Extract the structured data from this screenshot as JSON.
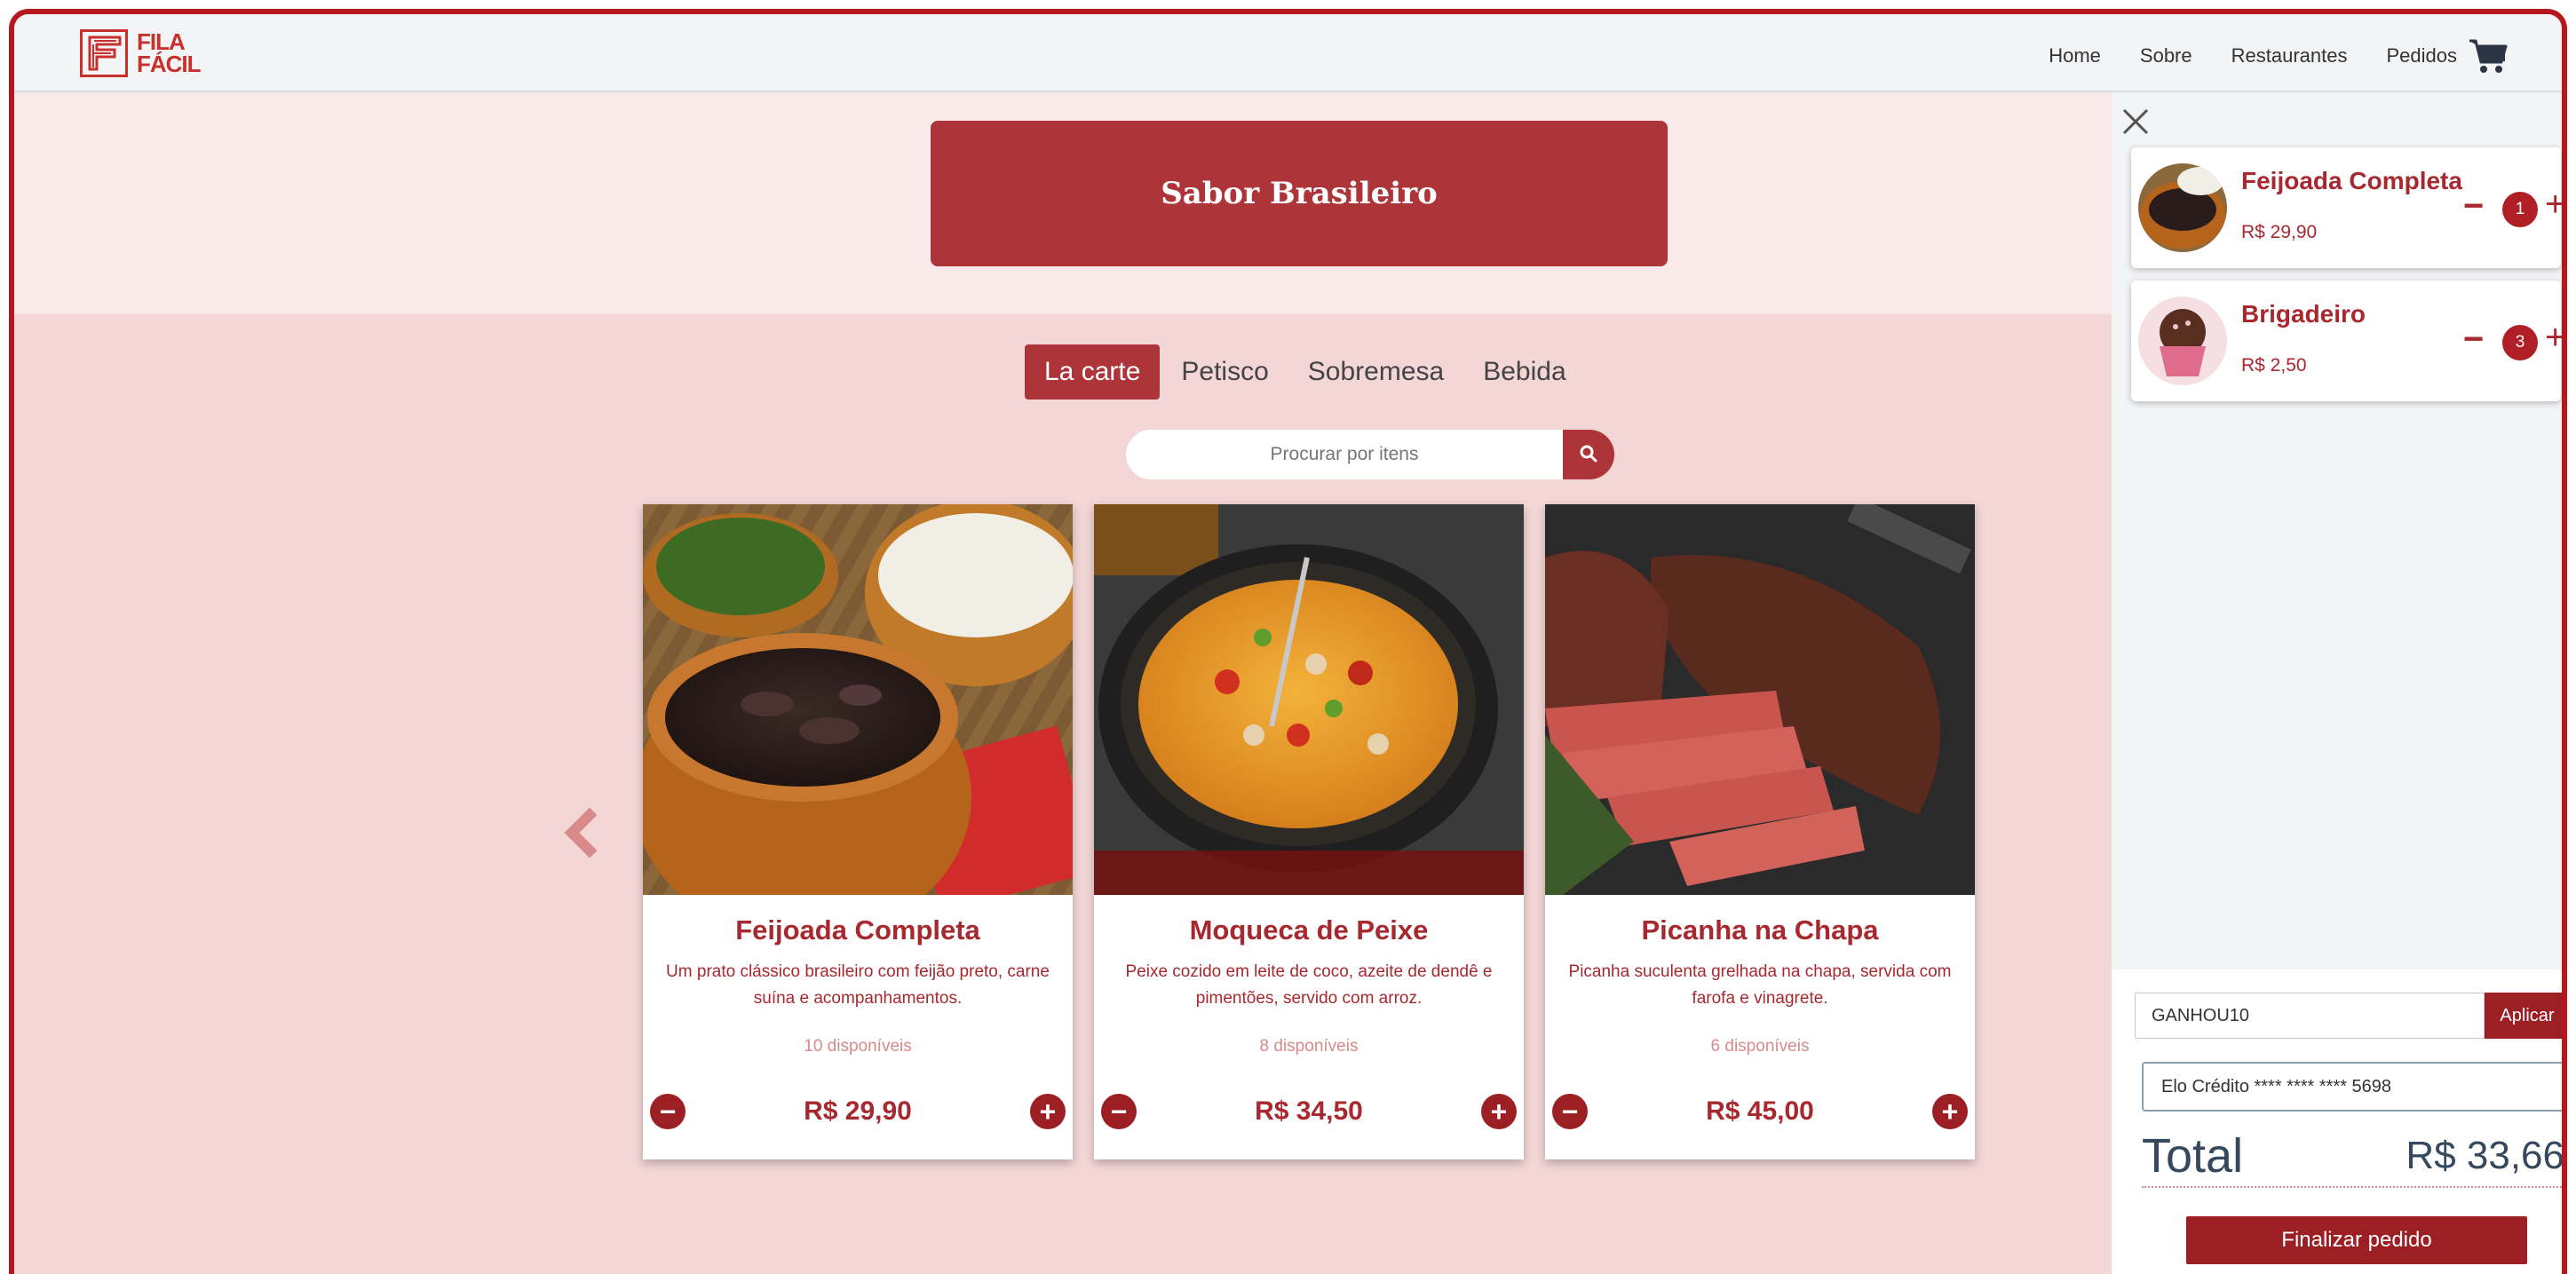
{
  "brand": {
    "logo_line1": "FILA",
    "logo_line2": "FÁCIL"
  },
  "nav": {
    "home": "Home",
    "about": "Sobre",
    "restaurants": "Restaurantes",
    "orders": "Pedidos"
  },
  "restaurant": {
    "name": "Sabor Brasileiro"
  },
  "tabs": [
    {
      "label": "La carte",
      "active": true
    },
    {
      "label": "Petisco",
      "active": false
    },
    {
      "label": "Sobremesa",
      "active": false
    },
    {
      "label": "Bebida",
      "active": false
    }
  ],
  "search": {
    "placeholder": "Procurar por itens"
  },
  "menu_items": [
    {
      "name": "Feijoada Completa",
      "description": "Um prato clássico brasileiro com feijão preto, carne suína e acompanhamentos.",
      "availability": "10 disponíveis",
      "price": "R$ 29,90"
    },
    {
      "name": "Moqueca de Peixe",
      "description": "Peixe cozido em leite de coco, azeite de dendê e pimentões, servido com arroz.",
      "availability": "8 disponíveis",
      "price": "R$ 34,50"
    },
    {
      "name": "Picanha na Chapa",
      "description": "Picanha suculenta grelhada na chapa, servida com farofa e vinagrete.",
      "availability": "6 disponíveis",
      "price": "R$ 45,00"
    }
  ],
  "cart": {
    "items": [
      {
        "name": "Feijoada Completa",
        "price": "R$ 29,90",
        "quantity": "1"
      },
      {
        "name": "Brigadeiro",
        "price": "R$ 2,50",
        "quantity": "3"
      }
    ],
    "coupon_value": "GANHOU10",
    "apply_label": "Aplicar",
    "payment_method": "Elo Crédito **** **** **** 5698",
    "total_label": "Total",
    "total_value": "R$ 33,66",
    "finish_label": "Finalizar pedido"
  },
  "colors": {
    "brand_red": "#ad3439",
    "dark_red": "#9c1f24",
    "page_bg": "#f3d6d6",
    "frame_border": "#b8161e"
  },
  "icons": {
    "cart": "cart-icon",
    "search": "search-icon",
    "close": "close-icon",
    "prev": "chevron-left-icon",
    "minus": "minus-icon",
    "plus": "plus-icon"
  }
}
